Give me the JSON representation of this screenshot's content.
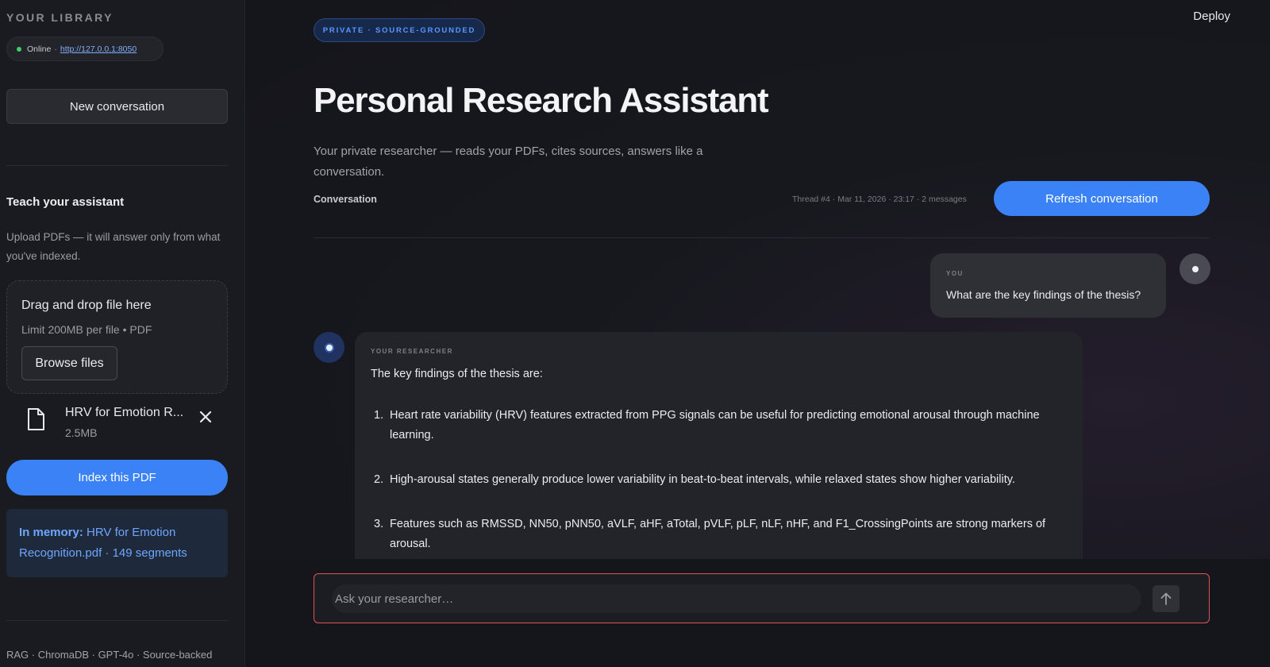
{
  "sidebar": {
    "library_title": "YOUR LIBRARY",
    "status": {
      "state": "Online",
      "separator": "·",
      "url": "http://127.0.0.1:8050"
    },
    "new_conversation_label": "New conversation",
    "teach": {
      "title": "Teach your assistant",
      "description": "Upload PDFs — it will answer only from what you've indexed."
    },
    "dropzone": {
      "title": "Drag and drop file here",
      "limit": "Limit 200MB per file • PDF",
      "browse_label": "Browse files"
    },
    "file": {
      "name": "HRV for Emotion R...",
      "size": "2.5MB",
      "icon": "file-icon",
      "remove_icon": "close-icon"
    },
    "index_button_label": "Index this PDF",
    "memory": {
      "label": "In memory:",
      "text": "HRV for Emotion Recognition.pdf · 149 segments"
    },
    "footer": "RAG · ChromaDB · GPT-4o · Source-backed"
  },
  "header": {
    "deploy_label": "Deploy"
  },
  "main": {
    "badge": "PRIVATE · SOURCE-GROUNDED",
    "title": "Personal Research Assistant",
    "subtitle": "Your private researcher — reads your PDFs, cites sources, answers like a conversation.",
    "conversation_label": "Conversation",
    "thread_meta": "Thread #4 · Mar 11, 2026 · 23:17 · 2 messages",
    "refresh_label": "Refresh conversation"
  },
  "messages": {
    "user": {
      "label": "YOU",
      "text": "What are the key findings of the thesis?"
    },
    "assistant": {
      "label": "YOUR RESEARCHER",
      "intro": "The key findings of the thesis are:",
      "items": [
        {
          "num": "1.",
          "text": "Heart rate variability (HRV) features extracted from PPG signals can be useful for predicting emotional arousal through machine learning."
        },
        {
          "num": "2.",
          "text": "High-arousal states generally produce lower variability in beat-to-beat intervals, while relaxed states show higher variability."
        },
        {
          "num": "3.",
          "text": "Features such as RMSSD, NN50, pNN50, aVLF, aHF, aTotal, pVLF, pLF, nLF, nHF, and F1_CrossingPoints are strong markers of arousal."
        }
      ]
    }
  },
  "chat_input": {
    "placeholder": "Ask your researcher…",
    "value": "",
    "send_icon": "arrow-up-icon"
  },
  "colors": {
    "accent": "#3b82f6",
    "online": "#3ecf6b",
    "input_border": "#e0525a",
    "badge_text": "#5c95ff",
    "memory_text": "#6ea6ff"
  }
}
